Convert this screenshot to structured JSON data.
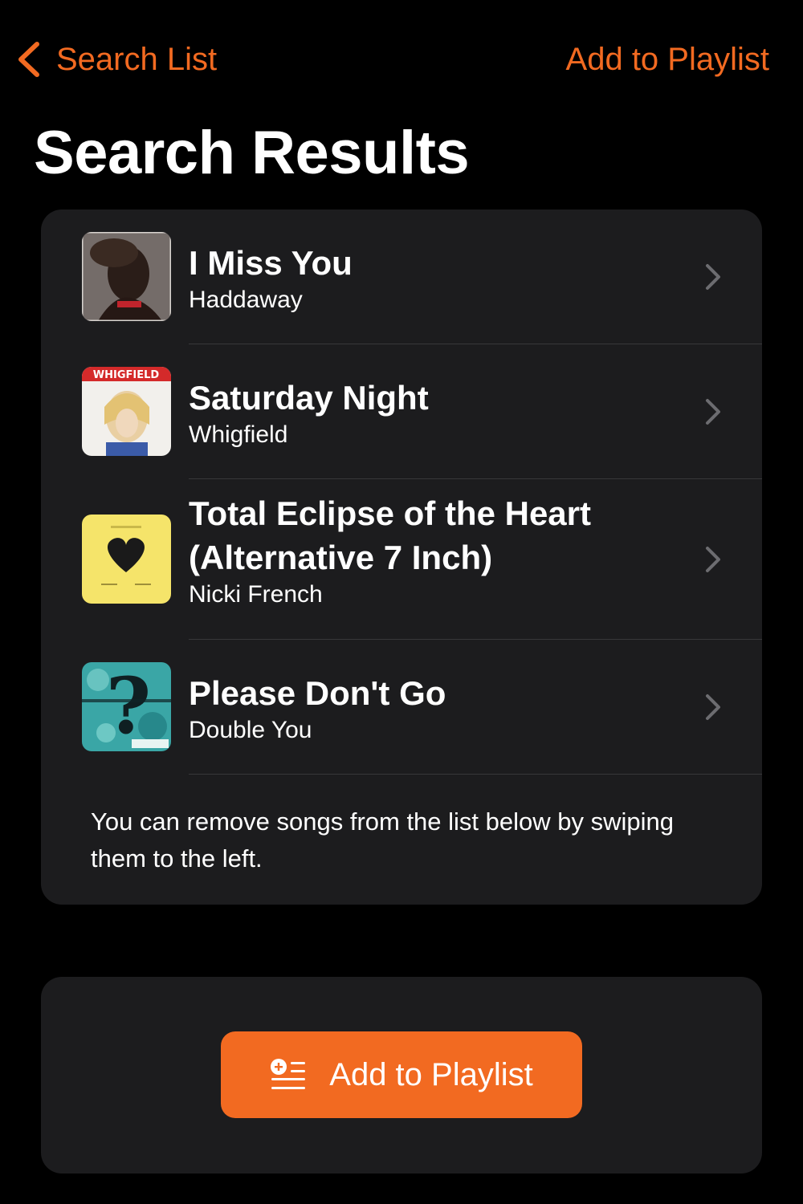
{
  "nav": {
    "back_label": "Search List",
    "action_label": "Add to Playlist"
  },
  "page": {
    "title": "Search Results"
  },
  "results": [
    {
      "title": "I Miss You",
      "artist": "Haddaway",
      "artwork_icon": "album-art-haddaway"
    },
    {
      "title": "Saturday Night",
      "artist": "Whigfield",
      "artwork_icon": "album-art-whigfield",
      "artwork_text": "WHIGFIELD"
    },
    {
      "title_line1": "Total Eclipse of the Heart",
      "title_line2": "(Alternative 7 Inch)",
      "artist": "Nicki French",
      "artwork_icon": "album-art-heart"
    },
    {
      "title": "Please Don't Go",
      "artist": "Double You",
      "artwork_icon": "album-art-question-mark"
    }
  ],
  "hint": "You can remove songs from the list below by swiping them to the left.",
  "footer": {
    "button_label": "Add to Playlist",
    "button_icon": "add-to-list-icon"
  },
  "colors": {
    "accent": "#f26a21",
    "background": "#000000",
    "card": "#1c1c1e",
    "separator": "#38383a"
  }
}
